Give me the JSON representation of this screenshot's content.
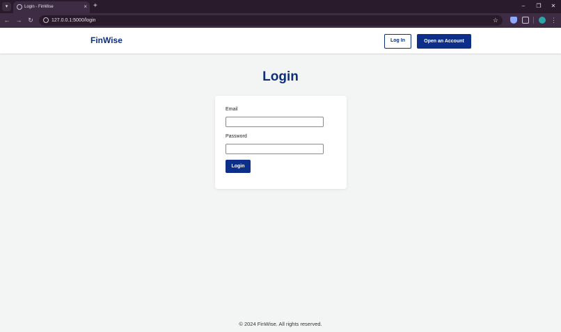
{
  "browser": {
    "tab_title": "Login - FinWise",
    "tab_close": "×",
    "new_tab": "+",
    "url": "127.0.0.1:5000/login",
    "tab_search_icon": "chevron-down-icon",
    "window_controls": {
      "minimize": "–",
      "restore": "❐",
      "close": "✕"
    },
    "nav": {
      "back": "←",
      "forward": "→",
      "reload": "↻"
    },
    "bookmark_icon": "☆",
    "menu_icon": "⋮"
  },
  "header": {
    "brand": "FinWise",
    "login_button": "Log In",
    "open_account_button": "Open an Account"
  },
  "main": {
    "title": "Login",
    "email_label": "Email",
    "email_value": "",
    "password_label": "Password",
    "password_value": "",
    "submit_label": "Login"
  },
  "footer": {
    "text": "© 2024 FinWise. All rights reserved."
  },
  "colors": {
    "brand": "#0d2f7a",
    "primary_button": "#0d2f8a",
    "page_background": "#f3f4f4",
    "browser_frame": "#3e2c44"
  }
}
